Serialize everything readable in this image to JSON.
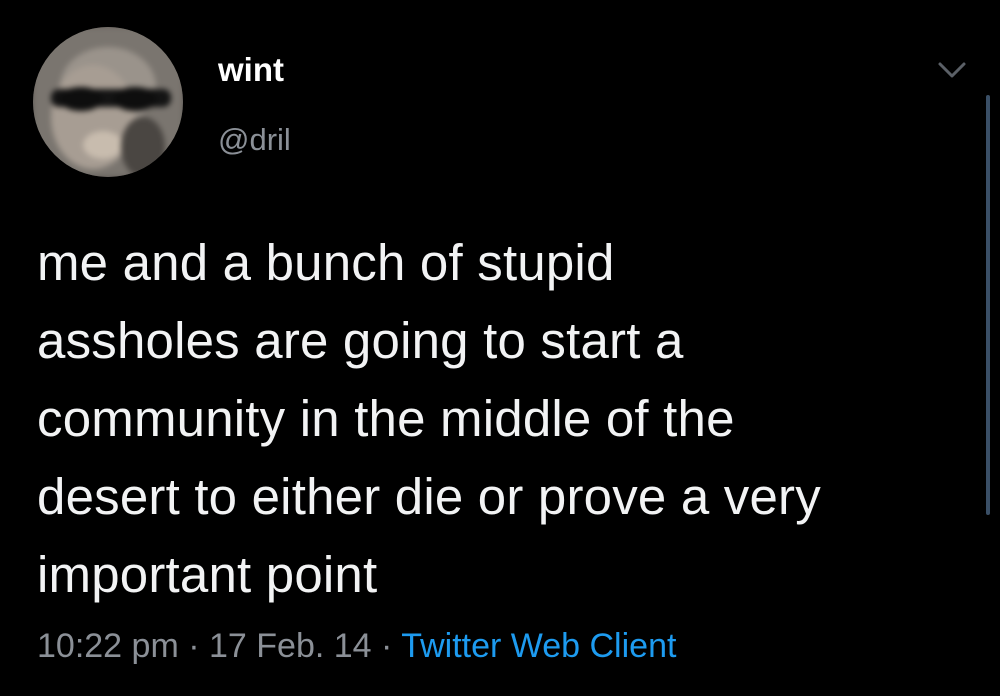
{
  "author": {
    "display_name": "wint",
    "handle": "@dril",
    "avatar_icon": "profile-photo"
  },
  "tweet": {
    "lines": [
      "me and a bunch of stupid",
      "assholes are going to start a",
      "community in the middle of the",
      "desert to either die or prove a very",
      "important point"
    ],
    "time": "10:22 pm",
    "separator": "·",
    "date": "17 Feb. 14",
    "source": "Twitter Web Client"
  },
  "icons": {
    "menu": "chevron-down-icon"
  },
  "colors": {
    "background": "#000000",
    "text": "#f2f3f4",
    "muted": "#8b9097",
    "link": "#1d9bf0"
  }
}
